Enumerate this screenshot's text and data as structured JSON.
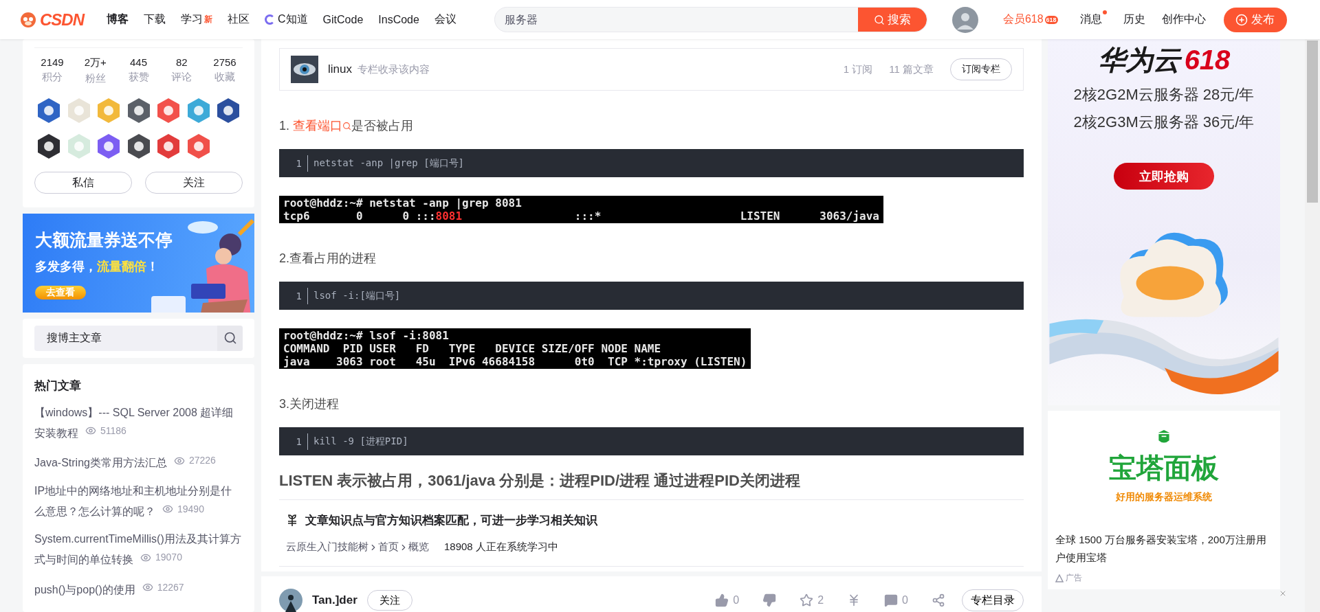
{
  "header": {
    "logo": "CSDN",
    "nav": [
      {
        "label": "博客",
        "selected": true
      },
      {
        "label": "下载",
        "selected": false
      },
      {
        "label": "学习",
        "selected": false,
        "badge": "新"
      },
      {
        "label": "社区",
        "selected": false
      },
      {
        "label": "C知道",
        "selected": false,
        "kind": "ai"
      },
      {
        "label": "GitCode",
        "selected": false
      },
      {
        "label": "InsCode",
        "selected": false
      },
      {
        "label": "会议",
        "selected": false
      }
    ],
    "search": {
      "placeholder": "服务器",
      "button": "搜索"
    },
    "vip": {
      "label": "会员618",
      "badge": "618"
    },
    "links": [
      {
        "label": "消息",
        "dot": true
      },
      {
        "label": "历史",
        "dot": false
      },
      {
        "label": "创作中心",
        "dot": false
      }
    ],
    "publish": "发布"
  },
  "sidebar": {
    "stats": [
      {
        "value": "2149",
        "label": "积分"
      },
      {
        "value": "2万+",
        "label": "粉丝"
      },
      {
        "value": "445",
        "label": "获赞"
      },
      {
        "value": "82",
        "label": "评论"
      },
      {
        "value": "2756",
        "label": "收藏"
      }
    ],
    "badges": [
      {
        "color": "#2f64c4"
      },
      {
        "color": "#e9e4d8"
      },
      {
        "color": "#f2b93b"
      },
      {
        "color": "#5b6068"
      },
      {
        "color": "#f2514b"
      },
      {
        "color": "#3daad8"
      },
      {
        "color": "#2b4f9e"
      },
      {
        "color": "#2e2e33"
      },
      {
        "color": "#d6ebde"
      },
      {
        "color": "#7c5ef2"
      },
      {
        "color": "#4a4b50"
      },
      {
        "color": "#e23c3c"
      },
      {
        "color": "#f0504a"
      }
    ],
    "buttons": [
      "私信",
      "关注"
    ],
    "banner": {
      "title": "大额流量券送不停",
      "subtitle_lead": "多发多得，",
      "subtitle_highlight": "流量翻倍",
      "subtitle_tail": "！",
      "button": "去查看"
    },
    "search": {
      "placeholder": "搜博主文章"
    },
    "hot": {
      "title": "热门文章",
      "items": [
        {
          "title": "【windows】--- SQL Server 2008 超详细安装教程",
          "views": "51186"
        },
        {
          "title": "Java-String类常用方法汇总",
          "views": "27226"
        },
        {
          "title": "IP地址中的网络地址和主机地址分别是什么意思？怎么计算的呢？",
          "views": "19490"
        },
        {
          "title": "System.currentTimeMillis()用法及其计算方式与时间的单位转换",
          "views": "19070"
        },
        {
          "title": "push()与pop()的使用",
          "views": "12267"
        }
      ]
    }
  },
  "article": {
    "column": {
      "name": "linux",
      "note": "专栏收录该内容",
      "subscribers": "1 订阅",
      "articles": "11 篇文章",
      "button": "订阅专栏"
    },
    "blocks": [
      {
        "kind": "step",
        "prefix": "1. ",
        "link": "查看端口",
        "suffix": "是否被占用"
      },
      {
        "kind": "code",
        "line": "1",
        "code": "netstat -anp |grep [端口号]"
      },
      {
        "kind": "terminal",
        "lines": [
          [
            {
              "text": "root@hddz:~# netstat -anp |grep 8081",
              "highlighted": false
            }
          ],
          [
            {
              "text": "tcp6       0      0 :::",
              "highlighted": false
            },
            {
              "text": "8081",
              "highlighted": true
            },
            {
              "text": "                 :::*                     LISTEN      3063/java",
              "highlighted": false
            }
          ]
        ]
      },
      {
        "kind": "step",
        "prefix": "2.查看占用的进程"
      },
      {
        "kind": "code",
        "line": "1",
        "code": "lsof -i:[端口号]"
      },
      {
        "kind": "terminal",
        "lines": [
          [
            {
              "text": "root@hddz:~# lsof -i:8081",
              "highlighted": false
            }
          ],
          [
            {
              "text": "COMMAND  PID USER   FD   TYPE   DEVICE SIZE/OFF NODE NAME",
              "highlighted": false
            }
          ],
          [
            {
              "text": "java    3063 root   45u  IPv6 46684158      0t0  TCP *:tproxy (LISTEN)",
              "highlighted": false
            }
          ]
        ]
      },
      {
        "kind": "step",
        "prefix": "3.关闭进程"
      },
      {
        "kind": "code",
        "line": "1",
        "code": "kill -9 [进程PID]"
      },
      {
        "kind": "heading",
        "text": "LISTEN 表示被占用，3061/java 分别是：进程PID/进程 通过进程PID关闭进程"
      }
    ],
    "knowledge": {
      "title": "文章知识点与官方知识档案匹配，可进一步学习相关知识",
      "path": [
        "云原生入门技能树",
        "首页",
        "概览"
      ],
      "learners": "18908 人正在系统学习中"
    },
    "toolbar": {
      "author": "Tan.]der",
      "follow": "关注",
      "actions": [
        {
          "kind": "like",
          "count": "0"
        },
        {
          "kind": "dislike"
        },
        {
          "kind": "star",
          "count": "2"
        },
        {
          "kind": "reward"
        },
        {
          "kind": "comment",
          "count": "0"
        },
        {
          "kind": "share"
        }
      ],
      "catalog": "专栏目录"
    }
  },
  "ads": {
    "cloud": {
      "brand": "华为云",
      "promo": "618",
      "lines": [
        "2核2G2M云服务器 28元/年",
        "2核2G3M云服务器 36元/年"
      ],
      "button": "立即抢购"
    },
    "panel": {
      "title": "宝塔面板",
      "slogan": "好用的服务器运维系统",
      "description": "全球 1500 万台服务器安装宝塔，200万注册用户使用宝塔",
      "label": "广告"
    }
  }
}
